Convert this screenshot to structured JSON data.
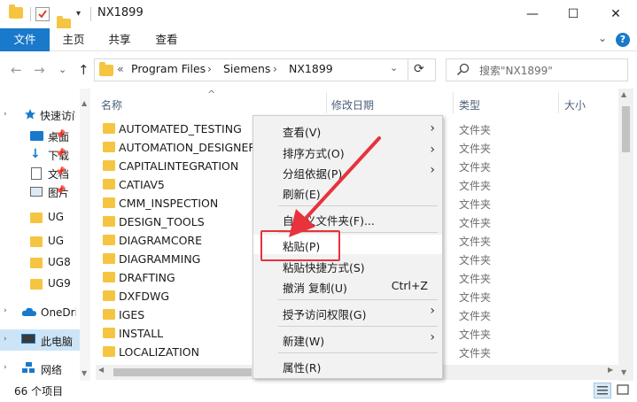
{
  "window": {
    "title": "NX1899",
    "minimize_glyph": "—",
    "maximize_glyph": "☐",
    "close_glyph": "✕"
  },
  "ribbon": {
    "tabs": [
      "文件",
      "主页",
      "共享",
      "查看"
    ],
    "help_glyph": "?",
    "collapse_glyph": "⌄"
  },
  "address": {
    "prefix": "«",
    "path": [
      "Program Files",
      "Siemens",
      "NX1899"
    ],
    "separator": "›",
    "dropdown_glyph": "⌄",
    "refresh_glyph": "⟳"
  },
  "search": {
    "placeholder": "搜索\"NX1899\""
  },
  "nav": {
    "back": "←",
    "forward": "→",
    "recent": "⌄",
    "up": "↑"
  },
  "leftpane": {
    "quick_access": "快速访问",
    "items": [
      {
        "label": "桌面",
        "icon": "desktop-icon"
      },
      {
        "label": "下载",
        "icon": "download-icon"
      },
      {
        "label": "文档",
        "icon": "document-icon"
      },
      {
        "label": "图片",
        "icon": "picture-icon"
      },
      {
        "label": "UG",
        "icon": "folder-icon"
      },
      {
        "label": "UG",
        "icon": "folder-icon"
      },
      {
        "label": "UG8",
        "icon": "folder-icon"
      },
      {
        "label": "UG9",
        "icon": "folder-icon"
      }
    ],
    "onedrive": "OneDrive",
    "this_pc": "此电脑",
    "network": "网络"
  },
  "columns": {
    "name": "名称",
    "modified": "修改日期",
    "type": "类型",
    "size": "大小",
    "sort_glyph": "^"
  },
  "files": [
    "AUTOMATED_TESTING",
    "AUTOMATION_DESIGNER",
    "CAPITALINTEGRATION",
    "CATIAV5",
    "CMM_INSPECTION",
    "DESIGN_TOOLS",
    "DIAGRAMCORE",
    "DIAGRAMMING",
    "DRAFTING",
    "DXFDWG",
    "IGES",
    "INSTALL",
    "LOCALIZATION"
  ],
  "file_type": "文件夹",
  "status": {
    "count": "66 个项目"
  },
  "context_menu": {
    "view": "查看(V)",
    "sort": "排序方式(O)",
    "group": "分组依据(P)",
    "refresh": "刷新(E)",
    "customize": "自定义文件夹(F)...",
    "paste": "粘贴(P)",
    "paste_shortcut": "粘贴快捷方式(S)",
    "undo": "撤消 复制(U)",
    "undo_shortcut": "Ctrl+Z",
    "grant_access": "授予访问权限(G)",
    "new": "新建(W)",
    "properties": "属性(R)",
    "submenu_glyph": "›"
  },
  "colors": {
    "accent": "#1979ca",
    "annotation": "#e8323c",
    "folder": "#f5c542"
  }
}
